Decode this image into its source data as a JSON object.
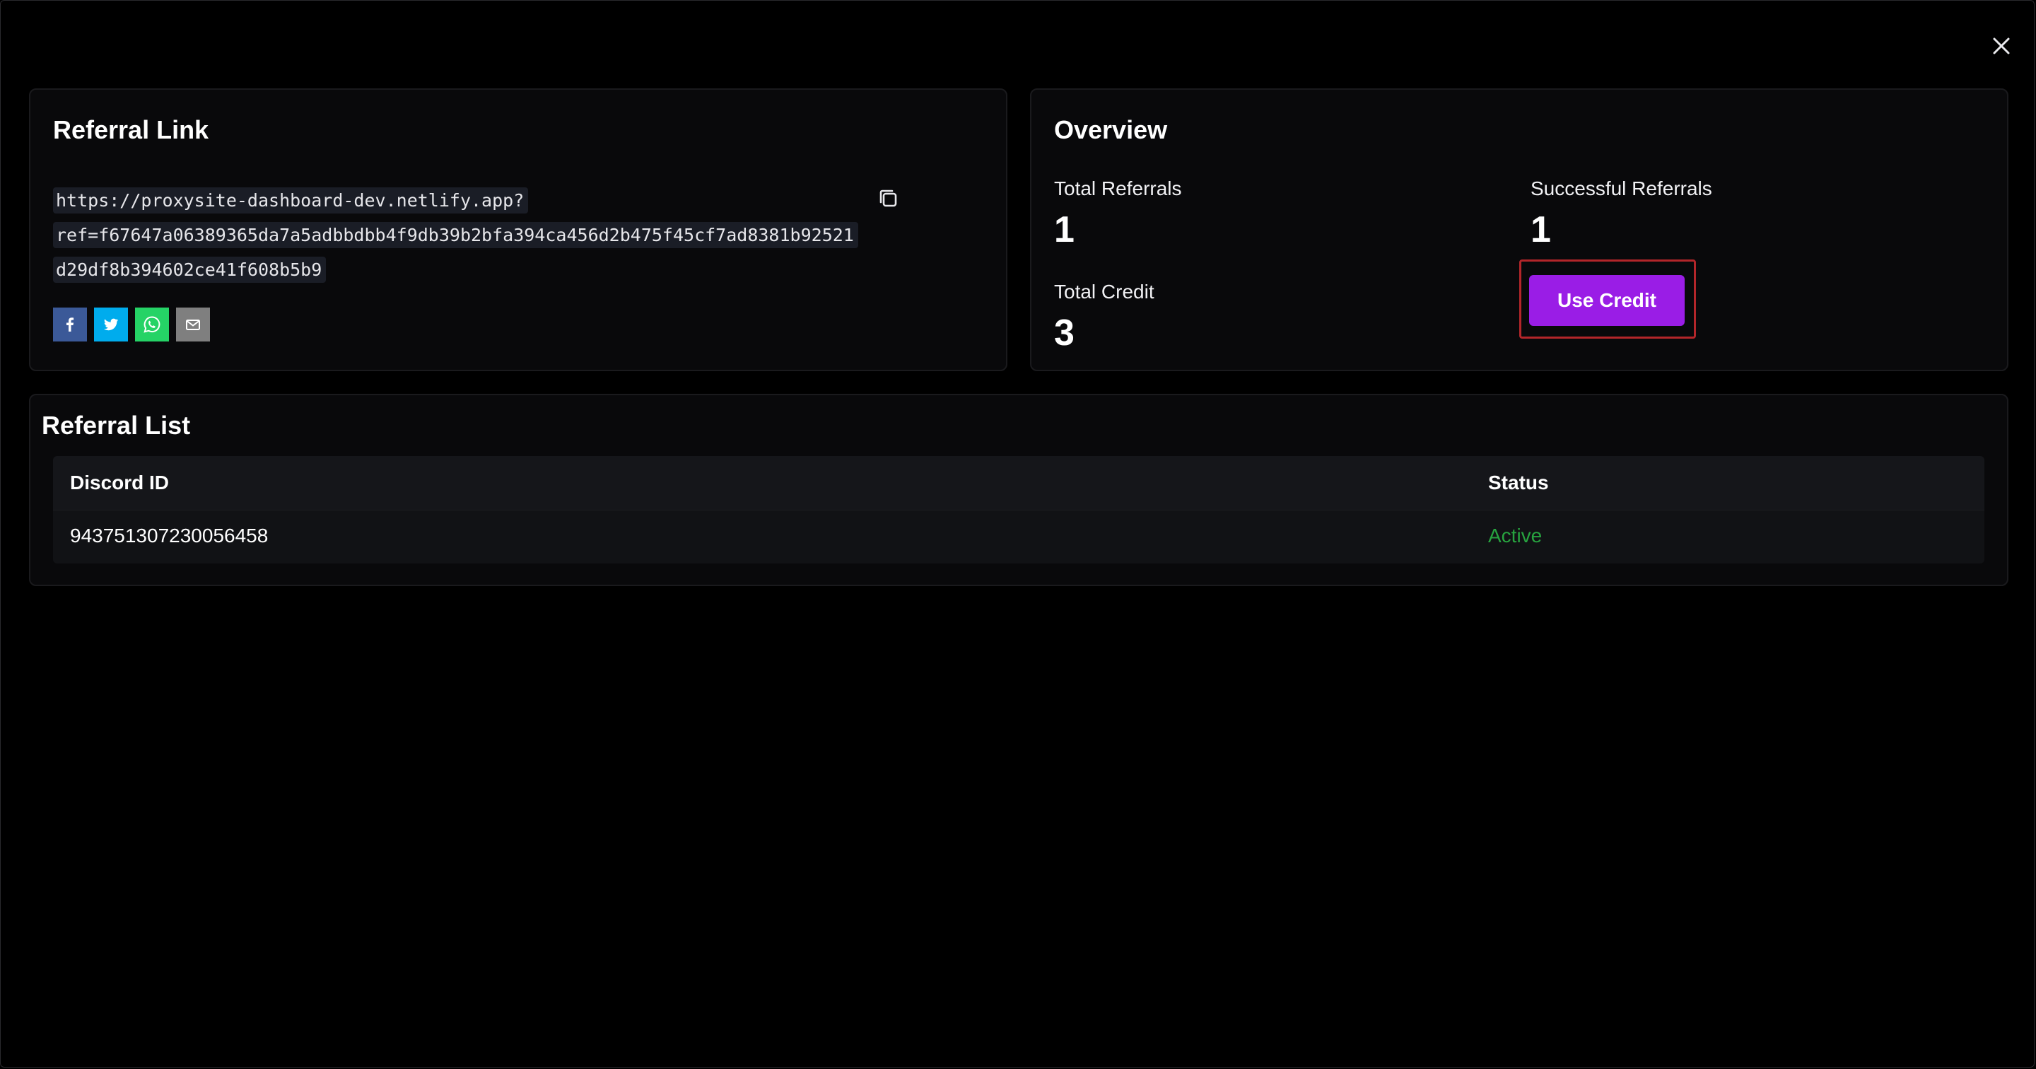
{
  "modal": {
    "close_icon": "close-icon"
  },
  "referral_link": {
    "title": "Referral Link",
    "url_line1": "https://proxysite-dashboard-dev.netlify.app?",
    "url_line2": "ref=f67647a06389365da7a5adbbdbb4f9db39b2bfa394ca456d2b475f45cf7ad8381b92521",
    "url_line3": "d29df8b394602ce41f608b5b9",
    "copy_icon": "copy-icon",
    "share": [
      {
        "name": "facebook-share-button",
        "icon": "facebook-icon",
        "color": "#3b5998"
      },
      {
        "name": "twitter-share-button",
        "icon": "twitter-icon",
        "color": "#00aced"
      },
      {
        "name": "whatsapp-share-button",
        "icon": "whatsapp-icon",
        "color": "#25d366"
      },
      {
        "name": "email-share-button",
        "icon": "email-icon",
        "color": "#7f7f7f"
      }
    ]
  },
  "overview": {
    "title": "Overview",
    "total_referrals_label": "Total Referrals",
    "total_referrals_value": "1",
    "successful_referrals_label": "Successful Referrals",
    "successful_referrals_value": "1",
    "total_credit_label": "Total Credit",
    "total_credit_value": "3",
    "use_credit_label": "Use Credit"
  },
  "referral_list": {
    "title": "Referral List",
    "columns": [
      "Discord ID",
      "Status"
    ],
    "rows": [
      {
        "discord_id": "943751307230056458",
        "status": "Active"
      }
    ]
  },
  "colors": {
    "accent": "#9a1de6",
    "status_active": "#27a33f",
    "highlight_outline": "#b3262a"
  }
}
